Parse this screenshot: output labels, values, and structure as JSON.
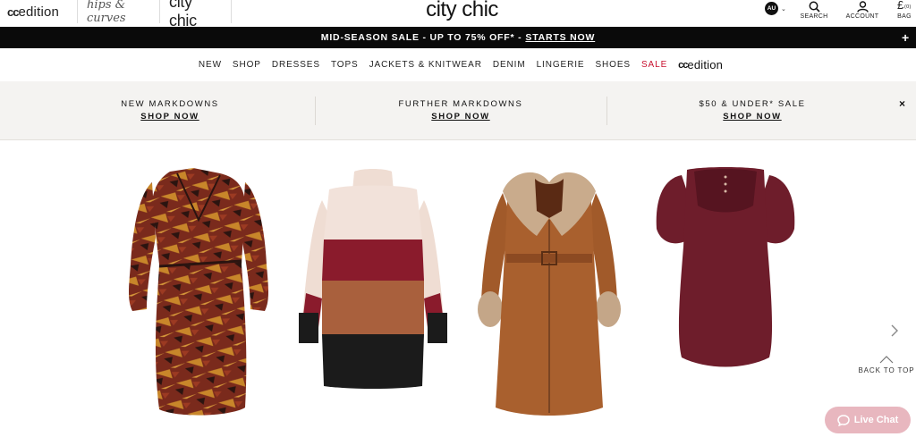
{
  "brand_tabs": {
    "cc_edition": {
      "cc": "cc",
      "edition": "edition"
    },
    "hips_curves": "hips & curves",
    "city_chic": "city chic"
  },
  "header": {
    "logo": "city chic",
    "locale": "AU",
    "search_label": "SEARCH",
    "account_label": "ACCOUNT",
    "bag_label": "BAG",
    "bag_count": "(0)",
    "bag_currency": "£"
  },
  "promo": {
    "text": "MID-SEASON SALE - UP TO 75% OFF* -",
    "link": "STARTS NOW",
    "expand_glyph": "+"
  },
  "nav": {
    "items": [
      "NEW",
      "SHOP",
      "DRESSES",
      "TOPS",
      "JACKETS & KNITWEAR",
      "DENIM",
      "LINGERIE",
      "SHOES",
      "SALE"
    ],
    "ccedition": {
      "cc": "cc",
      "edition": "edition"
    }
  },
  "banner": {
    "columns": [
      {
        "title": "NEW MARKDOWNS",
        "link": "SHOP NOW"
      },
      {
        "title": "FURTHER MARKDOWNS",
        "link": "SHOP NOW"
      },
      {
        "title": "$50 & UNDER* SALE",
        "link": "SHOP NOW"
      }
    ],
    "close_glyph": "×"
  },
  "products": [
    {
      "name": "wrap-dress",
      "colors": [
        "#7a2a1c",
        "#c8862a",
        "#2b1410"
      ]
    },
    {
      "name": "colorblock-knit-dress",
      "colors": [
        "#efddd3",
        "#8a1b2c",
        "#a9603d",
        "#1b1b1b"
      ]
    },
    {
      "name": "faux-leather-trench-coat",
      "colors": [
        "#a9602e",
        "#c4a688",
        "#6a3a1e"
      ]
    },
    {
      "name": "suede-tunic-dress",
      "colors": [
        "#6e1d2b",
        "#561420"
      ]
    }
  ],
  "back_to_top": "BACK TO TOP",
  "live_chat": "Live Chat",
  "colors": {
    "promo_bg": "#0a0a0a",
    "sale": "#c8102e",
    "banner_bg": "#f4f3f1",
    "chat": "#e8b7bf"
  }
}
